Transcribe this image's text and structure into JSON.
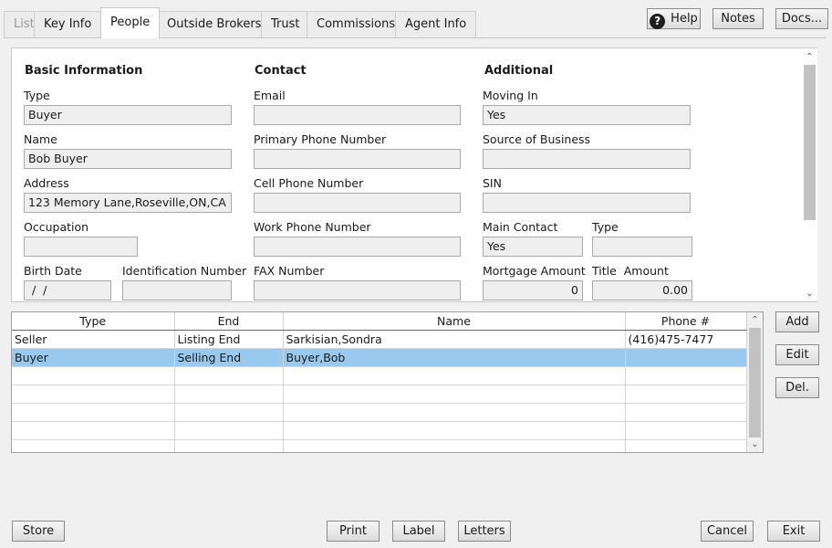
{
  "tabs": [
    {
      "label": "List",
      "state": "disabled"
    },
    {
      "label": "Key Info",
      "state": "normal"
    },
    {
      "label": "People",
      "state": "active"
    },
    {
      "label": "Outside Brokers",
      "state": "normal"
    },
    {
      "label": "Trust",
      "state": "normal"
    },
    {
      "label": "Commissions",
      "state": "normal"
    },
    {
      "label": "Agent Info",
      "state": "normal"
    }
  ],
  "top_buttons": {
    "help": "Help",
    "notes": "Notes",
    "docs": "Docs..."
  },
  "form": {
    "basic": {
      "heading": "Basic Information",
      "type_label": "Type",
      "type_value": "Buyer",
      "name_label": "Name",
      "name_value": "Bob Buyer",
      "address_label": "Address",
      "address_value": "123 Memory Lane,Roseville,ON,CA",
      "occupation_label": "Occupation",
      "occupation_value": "",
      "birth_date_label": "Birth Date",
      "birth_date_value": " /  /",
      "id_number_label": "Identification Number",
      "id_number_value": ""
    },
    "contact": {
      "heading": "Contact",
      "email_label": "Email",
      "email_value": "",
      "primary_phone_label": "Primary Phone Number",
      "primary_phone_value": "",
      "cell_phone_label": "Cell Phone Number",
      "cell_phone_value": "",
      "work_phone_label": "Work Phone Number",
      "work_phone_value": "",
      "fax_label": "FAX Number",
      "fax_value": ""
    },
    "additional": {
      "heading": "Additional",
      "moving_in_label": "Moving In",
      "moving_in_value": "Yes",
      "source_label": "Source of Business",
      "source_value": "",
      "sin_label": "SIN",
      "sin_value": "",
      "main_contact_label": "Main Contact",
      "main_contact_value": "Yes",
      "type_label": "Type",
      "type_value": "",
      "mortgage_label": "Mortgage Amount",
      "mortgage_value": "0",
      "title_amount_label": "Title  Amount",
      "title_amount_value": "0.00"
    }
  },
  "grid": {
    "columns": [
      "Type",
      "End",
      "Name",
      "Phone #"
    ],
    "rows": [
      [
        "Seller",
        "Listing End",
        "Sarkisian,Sondra",
        "(416)475-7477"
      ],
      [
        "Buyer",
        "Selling End",
        "Buyer,Bob",
        ""
      ],
      [
        "",
        "",
        "",
        ""
      ],
      [
        "",
        "",
        "",
        ""
      ],
      [
        "",
        "",
        "",
        ""
      ],
      [
        "",
        "",
        "",
        ""
      ],
      [
        "",
        "",
        "",
        ""
      ]
    ],
    "selected_row": 1
  },
  "side_buttons": {
    "add": "Add",
    "edit": "Edit",
    "del": "Del."
  },
  "bottom_buttons": {
    "store": "Store",
    "print": "Print",
    "label": "Label",
    "letters": "Letters",
    "cancel": "Cancel",
    "exit": "Exit"
  },
  "colors": {
    "selected_row": "#99c9ef",
    "panel_bg": "#ffffff",
    "window_bg": "#f0f0f0"
  }
}
